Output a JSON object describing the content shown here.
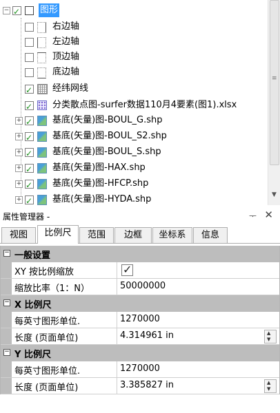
{
  "tree": {
    "root": {
      "label": "图形",
      "expand": "−"
    },
    "items": [
      {
        "label": "右边轴",
        "checked": false,
        "icon": "axis-right-icon"
      },
      {
        "label": "左边轴",
        "checked": false,
        "icon": "axis-left-icon"
      },
      {
        "label": "顶边轴",
        "checked": false,
        "icon": "axis-top-icon"
      },
      {
        "label": "底边轴",
        "checked": false,
        "icon": "axis-bottom-icon"
      },
      {
        "label": "经纬网线",
        "checked": true,
        "icon": "graticule-icon"
      },
      {
        "label": "分类散点图-surfer数据110月4要素(图1).xlsx",
        "checked": true,
        "icon": "scatter-icon"
      },
      {
        "label": "基底(矢量)图-BOUL_G.shp",
        "checked": true,
        "icon": "basemap-icon"
      },
      {
        "label": "基底(矢量)图-BOUL_S2.shp",
        "checked": true,
        "icon": "basemap-icon"
      },
      {
        "label": "基底(矢量)图-BOUL_S.shp",
        "checked": true,
        "icon": "basemap-icon"
      },
      {
        "label": "基底(矢量)图-HAX.shp",
        "checked": true,
        "icon": "basemap-icon"
      },
      {
        "label": "基底(矢量)图-HFCP.shp",
        "checked": true,
        "icon": "basemap-icon"
      },
      {
        "label": "基底(矢量)图-HYDA.shp",
        "checked": true,
        "icon": "basemap-icon"
      }
    ]
  },
  "property_manager": {
    "title": "属性管理器 -",
    "pin": "ᅮ",
    "close": "✕",
    "tabs": [
      "视图",
      "比例尺",
      "范围",
      "边框",
      "坐标系",
      "信息"
    ],
    "active_tab": "比例尺",
    "sections": {
      "general": {
        "label": "一般设置",
        "toggle": "−",
        "xy_scale_label": "XY 按比例缩放",
        "xy_scale_checked": true,
        "ratio_label": "缩放比率（1：N）",
        "ratio_value": "50000000"
      },
      "x_scale": {
        "label": "X 比例尺",
        "toggle": "−",
        "units_label": "每英寸图形单位.",
        "units_value": "1270000",
        "length_label": "长度 (页面单位)",
        "length_value": "4.314961 in"
      },
      "y_scale": {
        "label": "Y 比例尺",
        "toggle": "−",
        "units_label": "每英寸图形单位.",
        "units_value": "1270000",
        "length_label": "长度 (页面单位)",
        "length_value": "3.385827 in"
      }
    }
  }
}
